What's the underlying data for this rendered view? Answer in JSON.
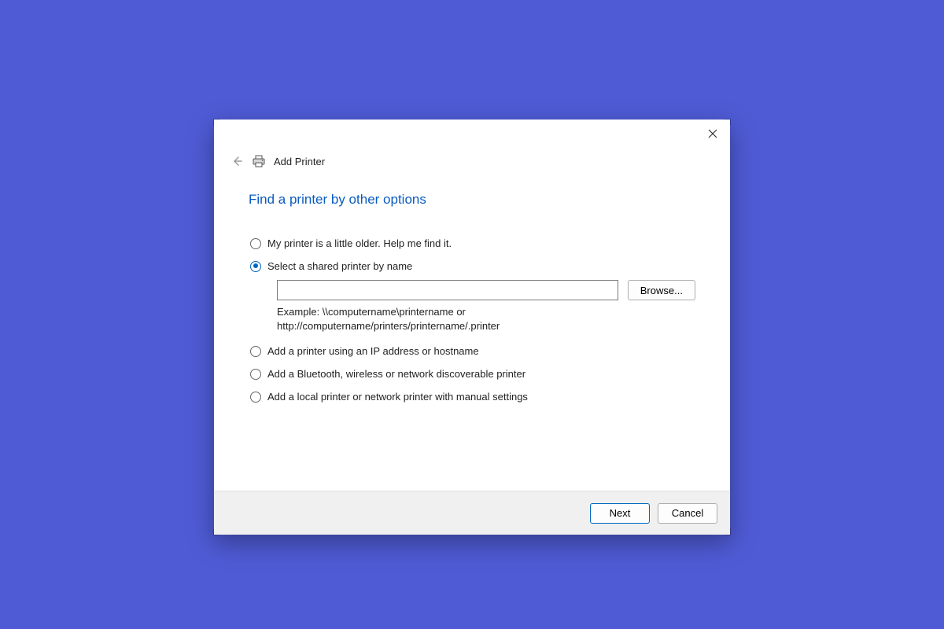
{
  "header": {
    "title": "Add Printer"
  },
  "instruction": "Find a printer by other options",
  "options": {
    "older": {
      "label": "My printer is a little older. Help me find it.",
      "selected": false
    },
    "shared": {
      "label": "Select a shared printer by name",
      "selected": true,
      "path_value": "",
      "browse_label": "Browse...",
      "example_text": "Example: \\\\computername\\printername or http://computername/printers/printername/.printer"
    },
    "tcpip": {
      "label": "Add a printer using an IP address or hostname",
      "selected": false
    },
    "bluetooth": {
      "label": "Add a Bluetooth, wireless or network discoverable printer",
      "selected": false
    },
    "manual": {
      "label": "Add a local printer or network printer with manual settings",
      "selected": false
    }
  },
  "footer": {
    "next_label": "Next",
    "cancel_label": "Cancel"
  }
}
